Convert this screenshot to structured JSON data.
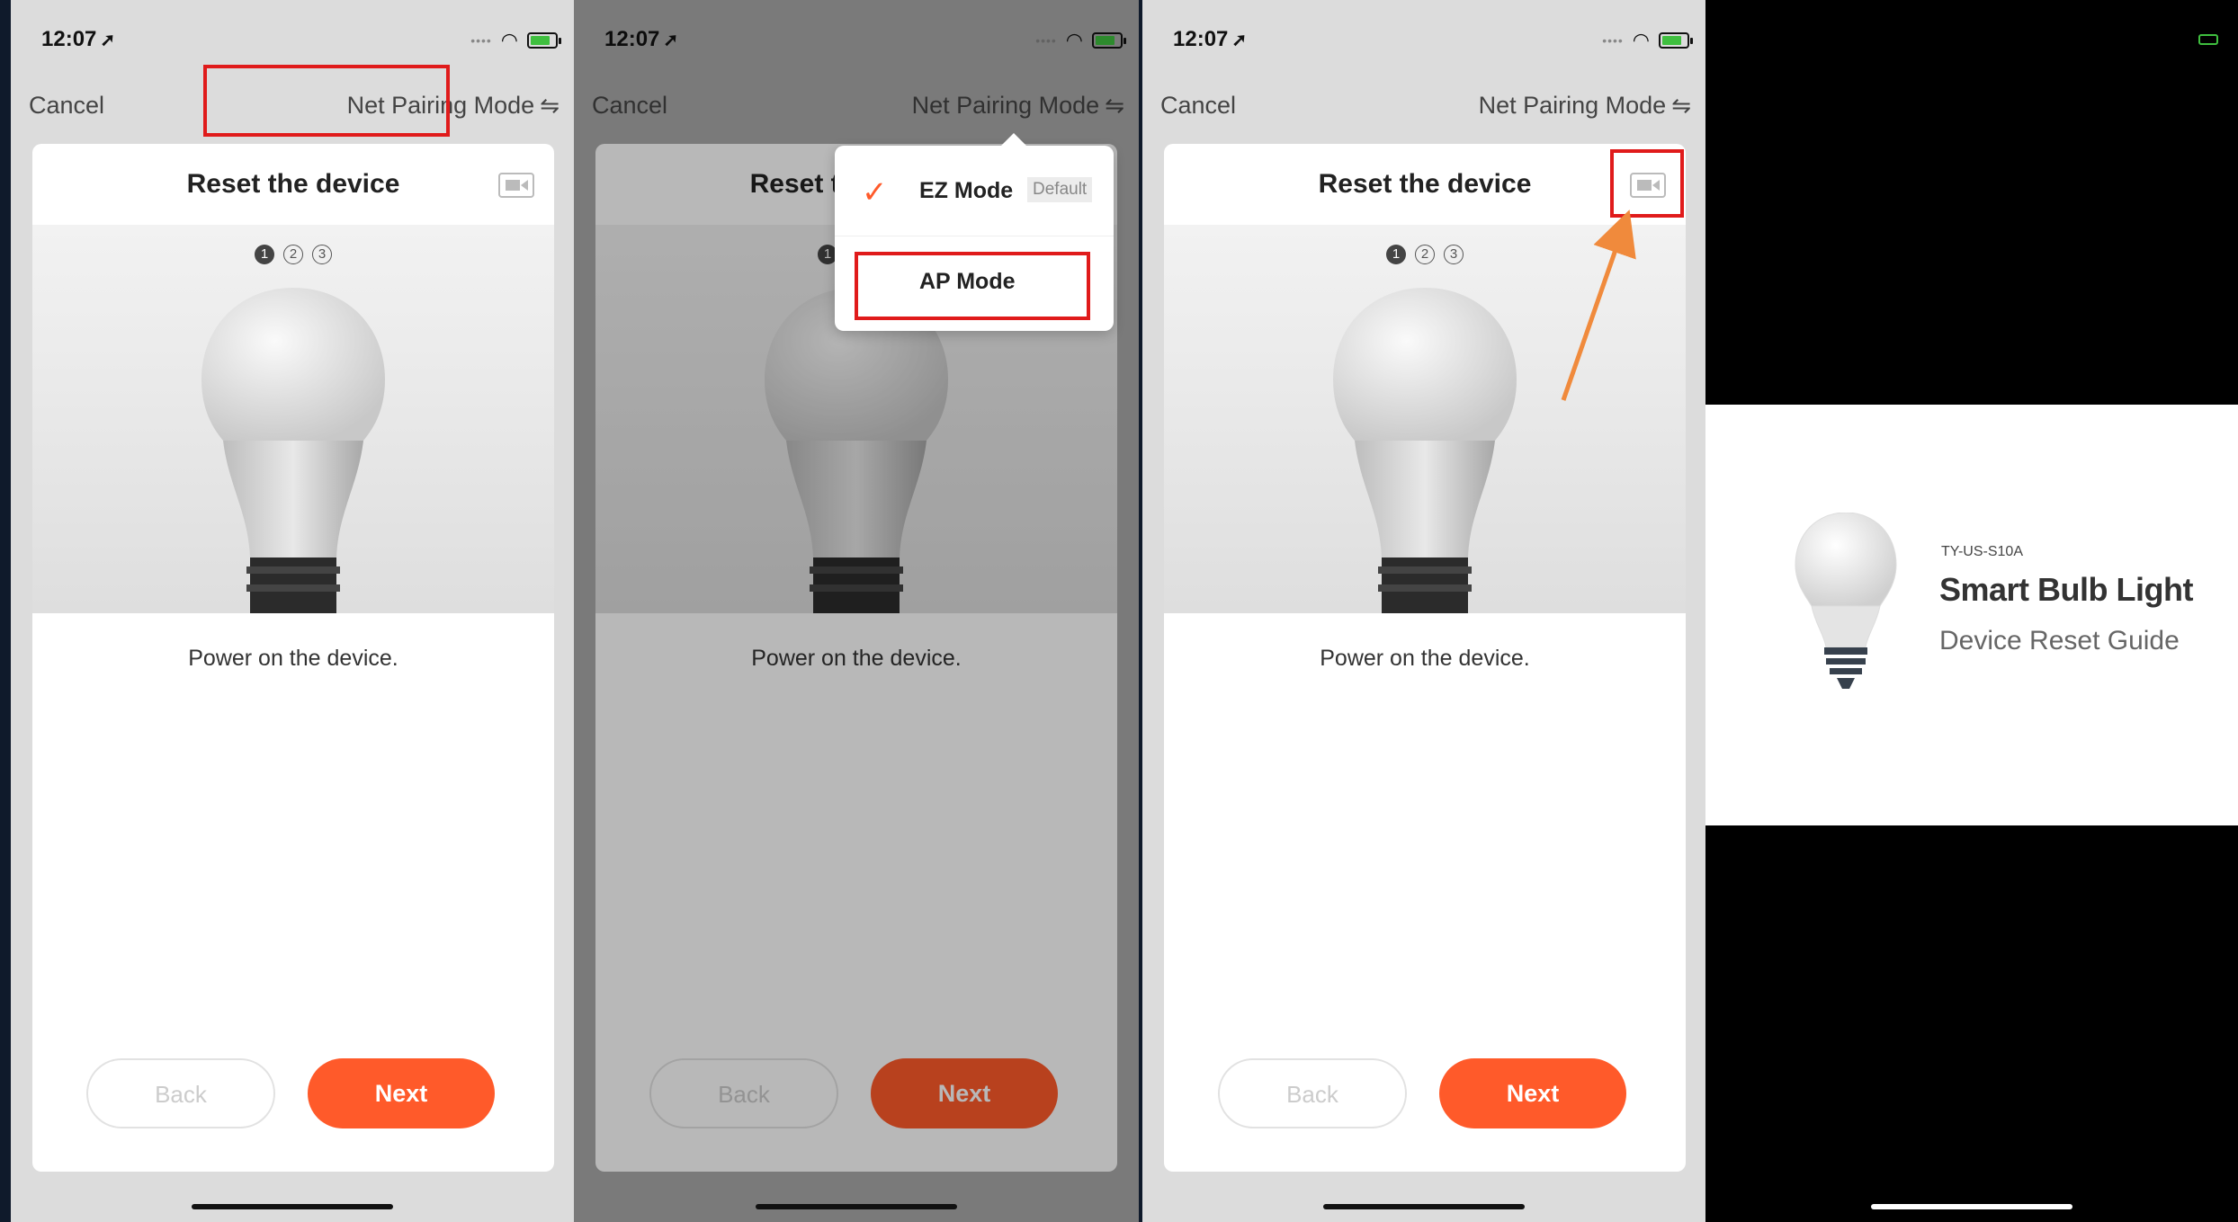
{
  "status_bar": {
    "time": "12:07",
    "location_glyph": "➚",
    "signal_dots": "••••"
  },
  "colors": {
    "accent": "#ff5a2a",
    "highlight_box": "#e01b1b",
    "annotation_arrow": "#f08a3c",
    "battery": "#3fbf3f"
  },
  "nav": {
    "cancel_label": "Cancel",
    "mode_label": "Net Pairing Mode",
    "mode_icon": "⇋"
  },
  "card": {
    "title": "Reset the device",
    "steps": [
      "1",
      "2",
      "3"
    ],
    "active_step": "1",
    "caption": "Power on the device.",
    "back_label": "Back",
    "next_label": "Next"
  },
  "mode_menu": {
    "options": [
      {
        "label": "EZ Mode",
        "badge": "Default",
        "selected": true
      },
      {
        "label": "AP Mode",
        "badge": "",
        "selected": false
      }
    ],
    "check_glyph": "✓"
  },
  "video": {
    "model": "TY-US-S10A",
    "title": "Smart Bulb Light",
    "subtitle": "Device Reset Guide"
  },
  "icons": {
    "video": "video-camera-icon",
    "bulb": "light-bulb-icon",
    "wifi": "wifi-icon",
    "battery": "battery-icon"
  }
}
